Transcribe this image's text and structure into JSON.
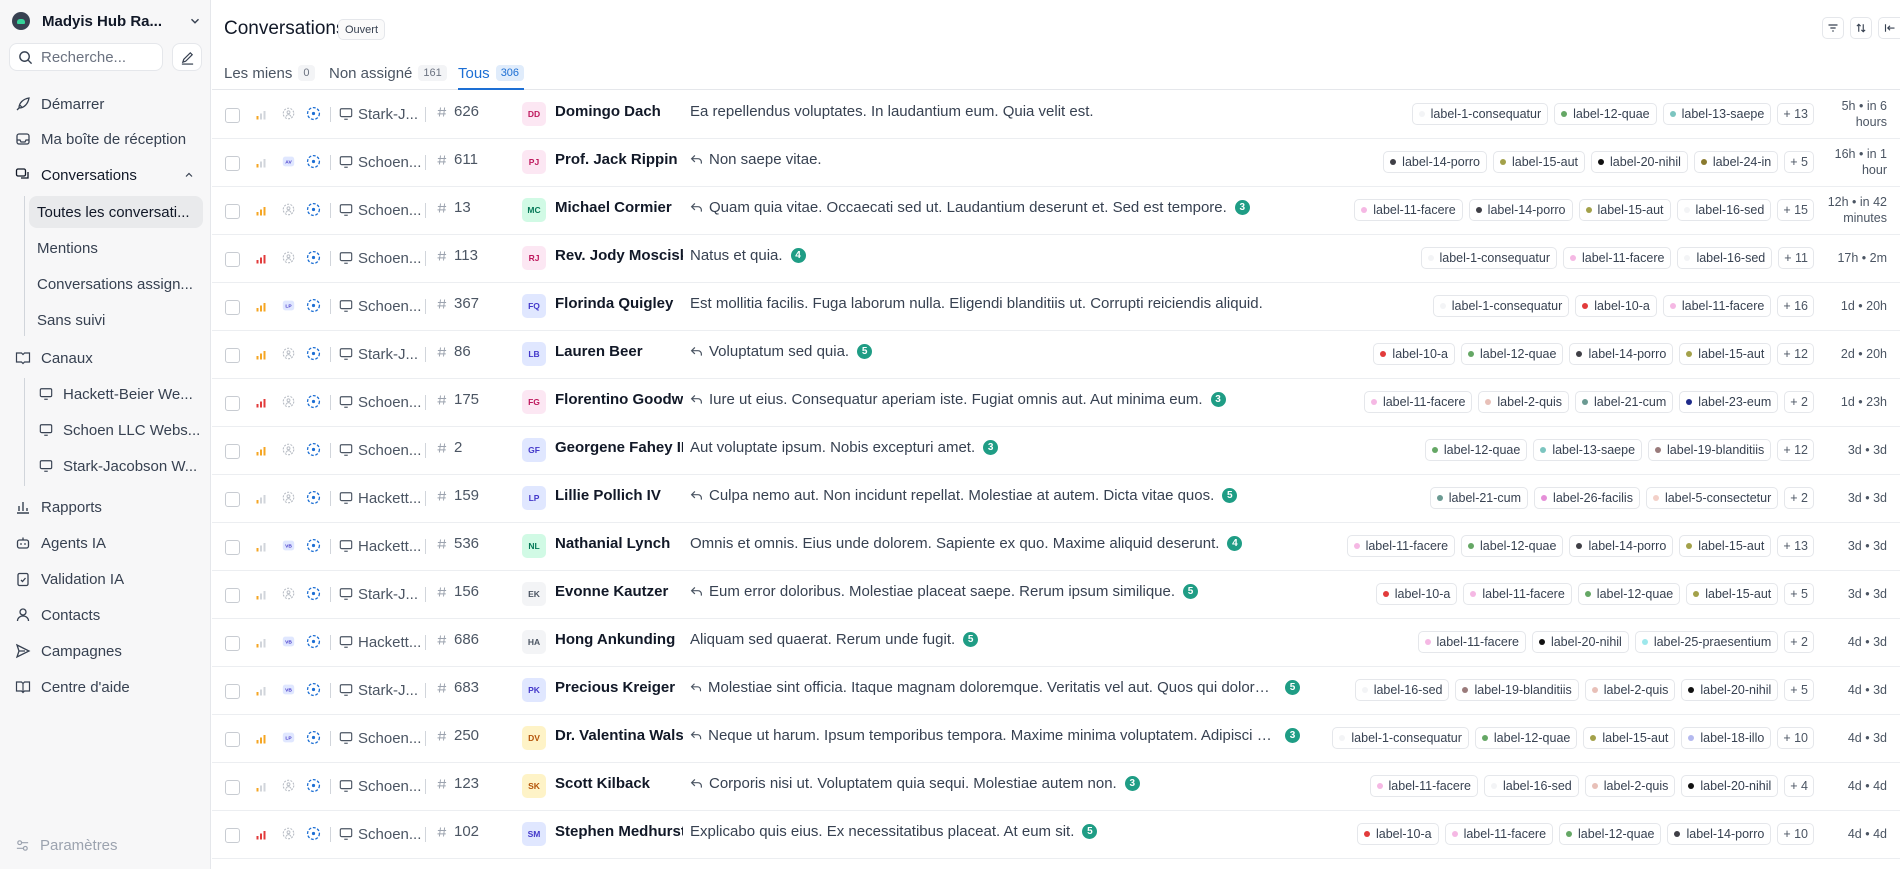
{
  "workspace": {
    "name": "Madyis Hub Ra..."
  },
  "search": {
    "placeholder": "Recherche..."
  },
  "nav": {
    "start": "Démarrer",
    "inbox": "Ma boîte de réception",
    "conversations": "Conversations",
    "sub": [
      "Toutes les conversati...",
      "Mentions",
      "Conversations assign...",
      "Sans suivi"
    ],
    "channels_header": "Canaux",
    "channels": [
      "Hackett-Beier We...",
      "Schoen LLC Webs...",
      "Stark-Jacobson W..."
    ],
    "reports": "Rapports",
    "ai_agents": "Agents IA",
    "ai_validation": "Validation IA",
    "contacts": "Contacts",
    "campaigns": "Campagnes",
    "help": "Centre d'aide",
    "settings": "Paramètres"
  },
  "header": {
    "title": "Conversations",
    "status_badge": "Ouvert",
    "tabs": [
      {
        "label": "Les miens",
        "count": "0"
      },
      {
        "label": "Non assigné",
        "count": "161"
      },
      {
        "label": "Tous",
        "count": "306"
      }
    ]
  },
  "colors": {
    "accent": "#1d6fd4",
    "unread": "#1f9d85"
  },
  "conversations": [
    {
      "prio": "low",
      "agent": "none",
      "inbox": "Stark-J...",
      "id": "626",
      "initials": "DD",
      "avbg": "#fce7f3",
      "avfg": "#be185d",
      "name": "Domingo Dach",
      "reply": false,
      "message": "Ea repellendus voluptates. In laudantium eum. Quia velit est.",
      "unread": "",
      "labels": [
        [
          "label-1-consequatur",
          "#f3f4f6"
        ],
        [
          "label-12-quae",
          "#65a765"
        ],
        [
          "label-13-saepe",
          "#7cc5c0"
        ]
      ],
      "more": "+ 13",
      "time": "5h • in 6 hours"
    },
    {
      "prio": "low",
      "agent": "AV",
      "inbox": "Schoen...",
      "id": "611",
      "initials": "PJ",
      "avbg": "#fce7f3",
      "avfg": "#be185d",
      "name": "Prof. Jack Rippin",
      "reply": true,
      "message": "Non saepe vitae.",
      "unread": "",
      "labels": [
        [
          "label-14-porro",
          "#3f3f46"
        ],
        [
          "label-15-aut",
          "#a3a14a"
        ],
        [
          "label-20-nihil",
          "#111111"
        ],
        [
          "label-24-in",
          "#8a7a2e"
        ]
      ],
      "more": "+ 5",
      "time": "16h • in 1 hour"
    },
    {
      "prio": "medium",
      "agent": "none",
      "inbox": "Schoen...",
      "id": "13",
      "initials": "MC",
      "avbg": "#d1fae5",
      "avfg": "#047857",
      "name": "Michael Cormier",
      "reply": true,
      "message": "Quam quia vitae. Occaecati sed ut. Laudantium deserunt et. Sed est tempore.",
      "unread": "3",
      "labels": [
        [
          "label-11-facere",
          "#f5b8e4"
        ],
        [
          "label-14-porro",
          "#3f3f46"
        ],
        [
          "label-15-aut",
          "#a3a14a"
        ],
        [
          "label-16-sed",
          "#f3f4f6"
        ]
      ],
      "more": "+ 15",
      "time": "12h • in 42 minutes"
    },
    {
      "prio": "urgent",
      "agent": "none",
      "inbox": "Schoen...",
      "id": "113",
      "initials": "RJ",
      "avbg": "#fce7f3",
      "avfg": "#be185d",
      "name": "Rev. Jody Mosciski",
      "reply": false,
      "message": "Natus et quia.",
      "unread": "4",
      "labels": [
        [
          "label-1-consequatur",
          "#f3f4f6"
        ],
        [
          "label-11-facere",
          "#f5b8e4"
        ],
        [
          "label-16-sed",
          "#f3f4f6"
        ]
      ],
      "more": "+ 11",
      "time": "17h • 2m"
    },
    {
      "prio": "medium",
      "agent": "LP",
      "inbox": "Schoen...",
      "id": "367",
      "initials": "FQ",
      "avbg": "#e0e7ff",
      "avfg": "#4338ca",
      "name": "Florinda Quigley",
      "reply": false,
      "message": "Est mollitia facilis. Fuga laborum nulla. Eligendi blanditiis ut. Corrupti reiciendis aliquid.",
      "unread": "",
      "labels": [
        [
          "label-1-consequatur",
          "#f3f4f6"
        ],
        [
          "label-10-a",
          "#e23b3b"
        ],
        [
          "label-11-facere",
          "#f5b8e4"
        ]
      ],
      "more": "+ 16",
      "time": "1d • 20h"
    },
    {
      "prio": "medium",
      "agent": "none",
      "inbox": "Stark-J...",
      "id": "86",
      "initials": "LB",
      "avbg": "#e0e7ff",
      "avfg": "#4338ca",
      "name": "Lauren Beer",
      "reply": true,
      "message": "Voluptatum sed quia.",
      "unread": "5",
      "labels": [
        [
          "label-10-a",
          "#e23b3b"
        ],
        [
          "label-12-quae",
          "#65a765"
        ],
        [
          "label-14-porro",
          "#3f3f46"
        ],
        [
          "label-15-aut",
          "#a3a14a"
        ]
      ],
      "more": "+ 12",
      "time": "2d • 20h"
    },
    {
      "prio": "urgent",
      "agent": "none",
      "inbox": "Schoen...",
      "id": "175",
      "initials": "FG",
      "avbg": "#fce7f3",
      "avfg": "#be185d",
      "name": "Florentino Goodwin",
      "reply": true,
      "message": "Iure ut eius. Consequatur aperiam iste. Fugiat omnis aut. Aut minima eum.",
      "unread": "3",
      "labels": [
        [
          "label-11-facere",
          "#f5b8e4"
        ],
        [
          "label-2-quis",
          "#e8c0b8"
        ],
        [
          "label-21-cum",
          "#6b9a92"
        ],
        [
          "label-23-eum",
          "#1e2a8a"
        ]
      ],
      "more": "+ 2",
      "time": "1d • 23h"
    },
    {
      "prio": "medium",
      "agent": "none",
      "inbox": "Schoen...",
      "id": "2",
      "initials": "GF",
      "avbg": "#e0e7ff",
      "avfg": "#4338ca",
      "name": "Georgene Fahey II",
      "reply": false,
      "message": "Aut voluptate ipsum. Nobis excepturi amet.",
      "unread": "3",
      "labels": [
        [
          "label-12-quae",
          "#65a765"
        ],
        [
          "label-13-saepe",
          "#7cc5c0"
        ],
        [
          "label-19-blanditiis",
          "#9a7b7b"
        ]
      ],
      "more": "+ 12",
      "time": "3d • 3d"
    },
    {
      "prio": "low",
      "agent": "none",
      "inbox": "Hackett...",
      "id": "159",
      "initials": "LP",
      "avbg": "#e0e7ff",
      "avfg": "#4338ca",
      "name": "Lillie Pollich IV",
      "reply": true,
      "message": "Culpa nemo aut. Non incidunt repellat. Molestiae at autem. Dicta vitae quos.",
      "unread": "5",
      "labels": [
        [
          "label-21-cum",
          "#6b9a92"
        ],
        [
          "label-26-facilis",
          "#e58fd8"
        ],
        [
          "label-5-consectetur",
          "#f3d0c8"
        ]
      ],
      "more": "+ 2",
      "time": "3d • 3d"
    },
    {
      "prio": "low",
      "agent": "VB",
      "inbox": "Hackett...",
      "id": "536",
      "initials": "NL",
      "avbg": "#d1fae5",
      "avfg": "#047857",
      "name": "Nathanial Lynch",
      "reply": false,
      "message": "Omnis et omnis. Eius unde dolorem. Sapiente ex quo. Maxime aliquid deserunt.",
      "unread": "4",
      "labels": [
        [
          "label-11-facere",
          "#f5b8e4"
        ],
        [
          "label-12-quae",
          "#65a765"
        ],
        [
          "label-14-porro",
          "#3f3f46"
        ],
        [
          "label-15-aut",
          "#a3a14a"
        ]
      ],
      "more": "+ 13",
      "time": "3d • 3d"
    },
    {
      "prio": "low",
      "agent": "none",
      "inbox": "Stark-J...",
      "id": "156",
      "initials": "EK",
      "avbg": "#f3f4f6",
      "avfg": "#4b5563",
      "name": "Evonne Kautzer",
      "reply": true,
      "message": "Eum error doloribus. Molestiae placeat saepe. Rerum ipsum similique.",
      "unread": "5",
      "labels": [
        [
          "label-10-a",
          "#e23b3b"
        ],
        [
          "label-11-facere",
          "#f5b8e4"
        ],
        [
          "label-12-quae",
          "#65a765"
        ],
        [
          "label-15-aut",
          "#a3a14a"
        ]
      ],
      "more": "+ 5",
      "time": "3d • 3d"
    },
    {
      "prio": "low",
      "agent": "VB",
      "inbox": "Hackett...",
      "id": "686",
      "initials": "HA",
      "avbg": "#f3f4f6",
      "avfg": "#4b5563",
      "name": "Hong Ankunding",
      "reply": false,
      "message": "Aliquam sed quaerat. Rerum unde fugit.",
      "unread": "5",
      "labels": [
        [
          "label-11-facere",
          "#f5b8e4"
        ],
        [
          "label-20-nihil",
          "#111111"
        ],
        [
          "label-25-praesentium",
          "#9ee8ec"
        ]
      ],
      "more": "+ 2",
      "time": "4d • 3d"
    },
    {
      "prio": "low",
      "agent": "VB",
      "inbox": "Stark-J...",
      "id": "683",
      "initials": "PK",
      "avbg": "#e0e7ff",
      "avfg": "#4338ca",
      "name": "Precious Kreiger",
      "reply": true,
      "message": "Molestiae sint officia. Itaque magnam doloremque. Veritatis vel aut. Quos qui dolorem. Expl...",
      "unread": "5",
      "labels": [
        [
          "label-16-sed",
          "#f3f4f6"
        ],
        [
          "label-19-blanditiis",
          "#9a7b7b"
        ],
        [
          "label-2-quis",
          "#e8c0b8"
        ],
        [
          "label-20-nihil",
          "#111111"
        ]
      ],
      "more": "+ 5",
      "time": "4d • 3d"
    },
    {
      "prio": "medium",
      "agent": "LP",
      "inbox": "Schoen...",
      "id": "250",
      "initials": "DV",
      "avbg": "#fef3c7",
      "avfg": "#b45309",
      "name": "Dr. Valentina Walsh",
      "reply": true,
      "message": "Neque ut harum. Ipsum temporibus tempora. Maxime minima voluptatem. Adipisci provide...",
      "unread": "3",
      "labels": [
        [
          "label-1-consequatur",
          "#f3f4f6"
        ],
        [
          "label-12-quae",
          "#65a765"
        ],
        [
          "label-15-aut",
          "#a3a14a"
        ],
        [
          "label-18-illo",
          "#b4b9ef"
        ]
      ],
      "more": "+ 10",
      "time": "4d • 3d"
    },
    {
      "prio": "low",
      "agent": "none",
      "inbox": "Schoen...",
      "id": "123",
      "initials": "SK",
      "avbg": "#fef3c7",
      "avfg": "#b45309",
      "name": "Scott Kilback",
      "reply": true,
      "message": "Corporis nisi ut. Voluptatem quia sequi. Molestiae autem non.",
      "unread": "3",
      "labels": [
        [
          "label-11-facere",
          "#f5b8e4"
        ],
        [
          "label-16-sed",
          "#f3f4f6"
        ],
        [
          "label-2-quis",
          "#e8c0b8"
        ],
        [
          "label-20-nihil",
          "#111111"
        ]
      ],
      "more": "+ 4",
      "time": "4d • 4d"
    },
    {
      "prio": "urgent",
      "agent": "none",
      "inbox": "Schoen...",
      "id": "102",
      "initials": "SM",
      "avbg": "#e0e7ff",
      "avfg": "#4338ca",
      "name": "Stephen Medhurst",
      "reply": false,
      "message": "Explicabo quis eius. Ex necessitatibus placeat. At eum sit.",
      "unread": "5",
      "labels": [
        [
          "label-10-a",
          "#e23b3b"
        ],
        [
          "label-11-facere",
          "#f5b8e4"
        ],
        [
          "label-12-quae",
          "#65a765"
        ],
        [
          "label-14-porro",
          "#3f3f46"
        ]
      ],
      "more": "+ 10",
      "time": "4d • 4d"
    }
  ]
}
